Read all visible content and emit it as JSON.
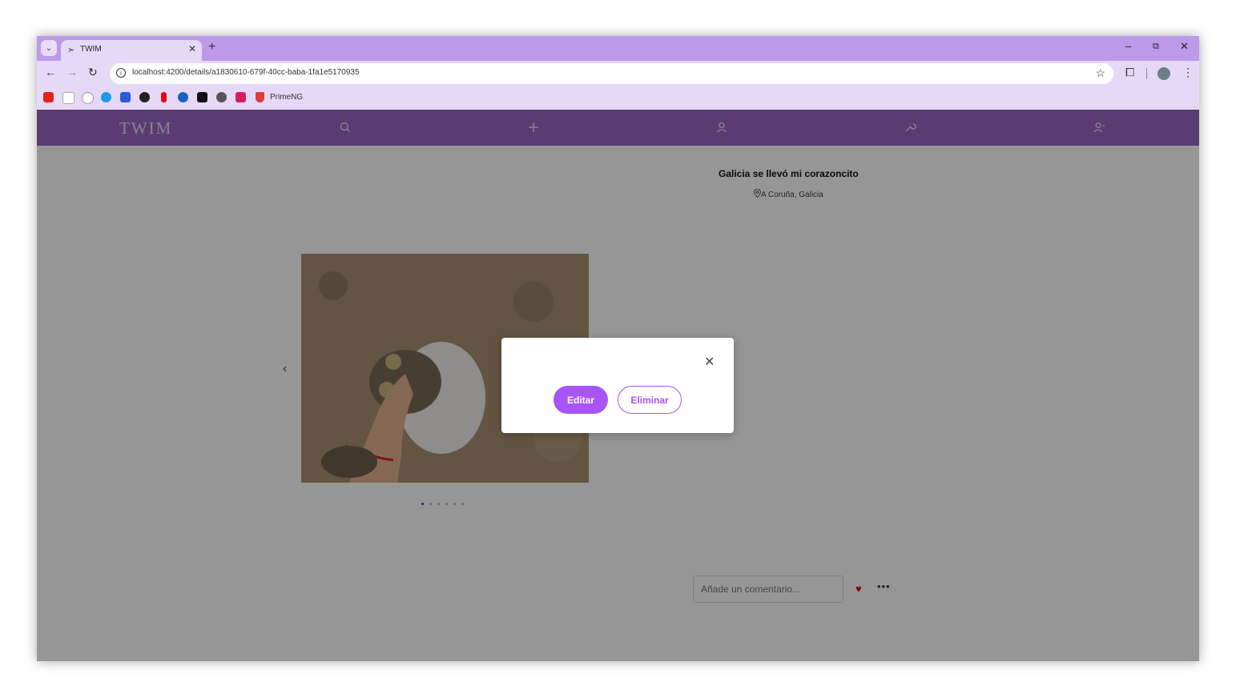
{
  "browser": {
    "tab_title": "TWIM",
    "url": "localhost:4200/details/a1830610-679f-40cc-baba-1fa1e5170935",
    "bookmark_label": "PrimeNG"
  },
  "app": {
    "brand": "TWIM",
    "nav_icons": [
      "search-icon",
      "plus-icon",
      "user-icon",
      "wrench-icon",
      "users-icon"
    ],
    "accent_color": "#a855f7",
    "nav_color": "#9966c2"
  },
  "post": {
    "title": "Galicia se llevó mi corazoncito",
    "location": "A Coruña, Galicia",
    "carousel_dot_count": 6,
    "carousel_active_index": 0
  },
  "comment": {
    "placeholder": "Añade un comentario..."
  },
  "dialog": {
    "edit_label": "Editar",
    "delete_label": "Eliminar"
  }
}
